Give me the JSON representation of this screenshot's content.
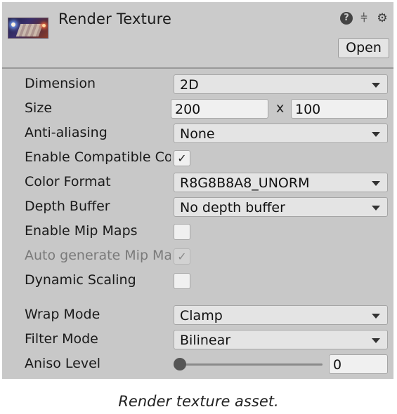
{
  "header": {
    "title": "Render Texture",
    "open_label": "Open",
    "icons": [
      "help-icon",
      "preset-sliders-icon",
      "gear-icon"
    ]
  },
  "fields": {
    "dimension": {
      "label": "Dimension",
      "value": "2D"
    },
    "size": {
      "label": "Size",
      "width": "200",
      "separator": "x",
      "height": "100"
    },
    "anti_aliasing": {
      "label": "Anti-aliasing",
      "value": "None"
    },
    "enable_compatible": {
      "label": "Enable Compatible Color Format",
      "checked": true
    },
    "color_format": {
      "label": "Color Format",
      "value": "R8G8B8A8_UNORM"
    },
    "depth_buffer": {
      "label": "Depth Buffer",
      "value": "No depth buffer"
    },
    "enable_mip_maps": {
      "label": "Enable Mip Maps",
      "checked": false
    },
    "auto_generate_mips": {
      "label": "Auto generate Mip Maps",
      "checked": true,
      "disabled": true
    },
    "dynamic_scaling": {
      "label": "Dynamic Scaling",
      "checked": false
    },
    "wrap_mode": {
      "label": "Wrap Mode",
      "value": "Clamp"
    },
    "filter_mode": {
      "label": "Filter Mode",
      "value": "Bilinear"
    },
    "aniso_level": {
      "label": "Aniso Level",
      "value": "0"
    }
  },
  "caption": "Render texture asset.",
  "colors": {
    "panel": "#c8c8c8",
    "field": "#e4e4e4",
    "text": "#1a1a1a"
  }
}
